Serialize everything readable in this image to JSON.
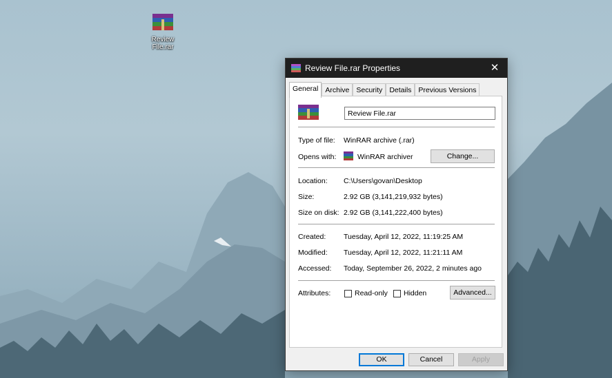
{
  "desktop": {
    "icon_label": "Review File.rar",
    "icon_name": "winrar-archive-icon"
  },
  "window": {
    "title": "Review File.rar Properties",
    "close_glyph": "✕",
    "tabs": [
      "General",
      "Archive",
      "Security",
      "Details",
      "Previous Versions"
    ],
    "active_tab": "General"
  },
  "general": {
    "file_name": "Review File.rar",
    "type_label": "Type of file:",
    "type_value": "WinRAR archive (.rar)",
    "opens_label": "Opens with:",
    "opens_value": "WinRAR archiver",
    "change_button": "Change...",
    "location_label": "Location:",
    "location_value": "C:\\Users\\govan\\Desktop",
    "size_label": "Size:",
    "size_value": "2.92 GB (3,141,219,932 bytes)",
    "size_disk_label": "Size on disk:",
    "size_disk_value": "2.92 GB (3,141,222,400 bytes)",
    "created_label": "Created:",
    "created_value": "Tuesday, April 12, 2022, 11:19:25 AM",
    "modified_label": "Modified:",
    "modified_value": "Tuesday, April 12, 2022, 11:21:11 AM",
    "accessed_label": "Accessed:",
    "accessed_value": "Today, September 26, 2022, 2 minutes ago",
    "attributes_label": "Attributes:",
    "readonly_label": "Read-only",
    "readonly_checked": false,
    "hidden_label": "Hidden",
    "hidden_checked": false,
    "advanced_button": "Advanced..."
  },
  "footer": {
    "ok": "OK",
    "cancel": "Cancel",
    "apply": "Apply"
  },
  "colors": {
    "titlebar": "#1f1f1f",
    "accent": "#0078d7",
    "panel": "#ffffff",
    "dialog": "#f0f0f0"
  }
}
